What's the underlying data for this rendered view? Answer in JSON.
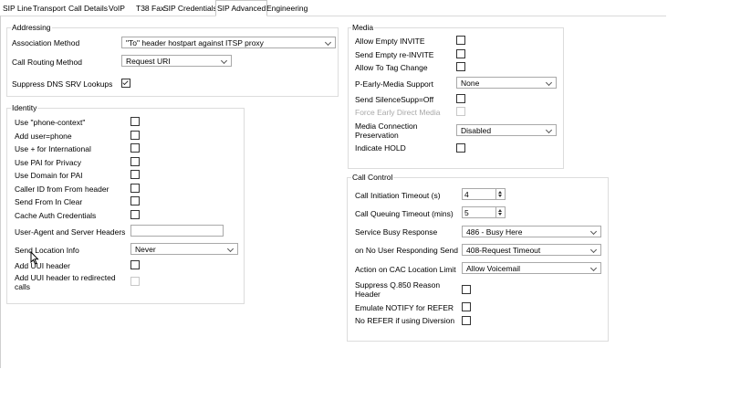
{
  "tabs": [
    "SIP Line",
    "Transport",
    "Call Details",
    "VoIP",
    "T38 Fax",
    "SIP Credentials",
    "SIP Advanced",
    "Engineering"
  ],
  "active_tab": "SIP Advanced",
  "addressing": {
    "legend": "Addressing",
    "association_method": {
      "label": "Association Method",
      "value": "\"To\" header hostpart against ITSP proxy"
    },
    "call_routing_method": {
      "label": "Call Routing Method",
      "value": "Request URI"
    },
    "suppress_dns_srv": {
      "label": "Suppress DNS SRV Lookups",
      "checked": true
    }
  },
  "identity": {
    "legend": "Identity",
    "checkboxes": [
      {
        "label": "Use \"phone-context\"",
        "checked": false
      },
      {
        "label": "Add user=phone",
        "checked": false
      },
      {
        "label": "Use + for International",
        "checked": false
      },
      {
        "label": "Use PAI for Privacy",
        "checked": false
      },
      {
        "label": "Use Domain for PAI",
        "checked": false
      },
      {
        "label": "Caller ID from From header",
        "checked": false
      },
      {
        "label": "Send From In Clear",
        "checked": false
      },
      {
        "label": "Cache Auth Credentials",
        "checked": false
      }
    ],
    "user_agent_label": "User-Agent and Server Headers",
    "user_agent_value": "",
    "send_location_label": "Send Location Info",
    "send_location_value": "Never",
    "add_uui_label": "Add UUI header",
    "add_uui_redirected_label": "Add UUI header to redirected calls"
  },
  "media": {
    "legend": "Media",
    "allow_empty_invite": "Allow Empty INVITE",
    "send_empty_reinvite": "Send Empty re-INVITE",
    "allow_to_tag_change": "Allow To Tag Change",
    "p_early_media_label": "P-Early-Media Support",
    "p_early_media_value": "None",
    "send_silencesupp": "Send SilenceSupp=Off",
    "force_early_direct_media": "Force Early Direct Media",
    "media_conn_pres_label": "Media Connection Preservation",
    "media_conn_pres_value": "Disabled",
    "indicate_hold": "Indicate HOLD"
  },
  "call_control": {
    "legend": "Call Control",
    "call_init_timeout_label": "Call Initiation Timeout (s)",
    "call_init_timeout_value": "4",
    "call_queue_timeout_label": "Call Queuing Timeout (mins)",
    "call_queue_timeout_value": "5",
    "service_busy_label": "Service Busy Response",
    "service_busy_value": "486 - Busy Here",
    "no_user_resp_label": "on No User Responding Send",
    "no_user_resp_value": "408-Request Timeout",
    "cac_limit_label": "Action on CAC Location Limit",
    "cac_limit_value": "Allow Voicemail",
    "suppress_q850_label": "Suppress Q.850 Reason Header",
    "emulate_notify_label": "Emulate NOTIFY for REFER",
    "no_refer_label": "No REFER if using Diversion"
  }
}
